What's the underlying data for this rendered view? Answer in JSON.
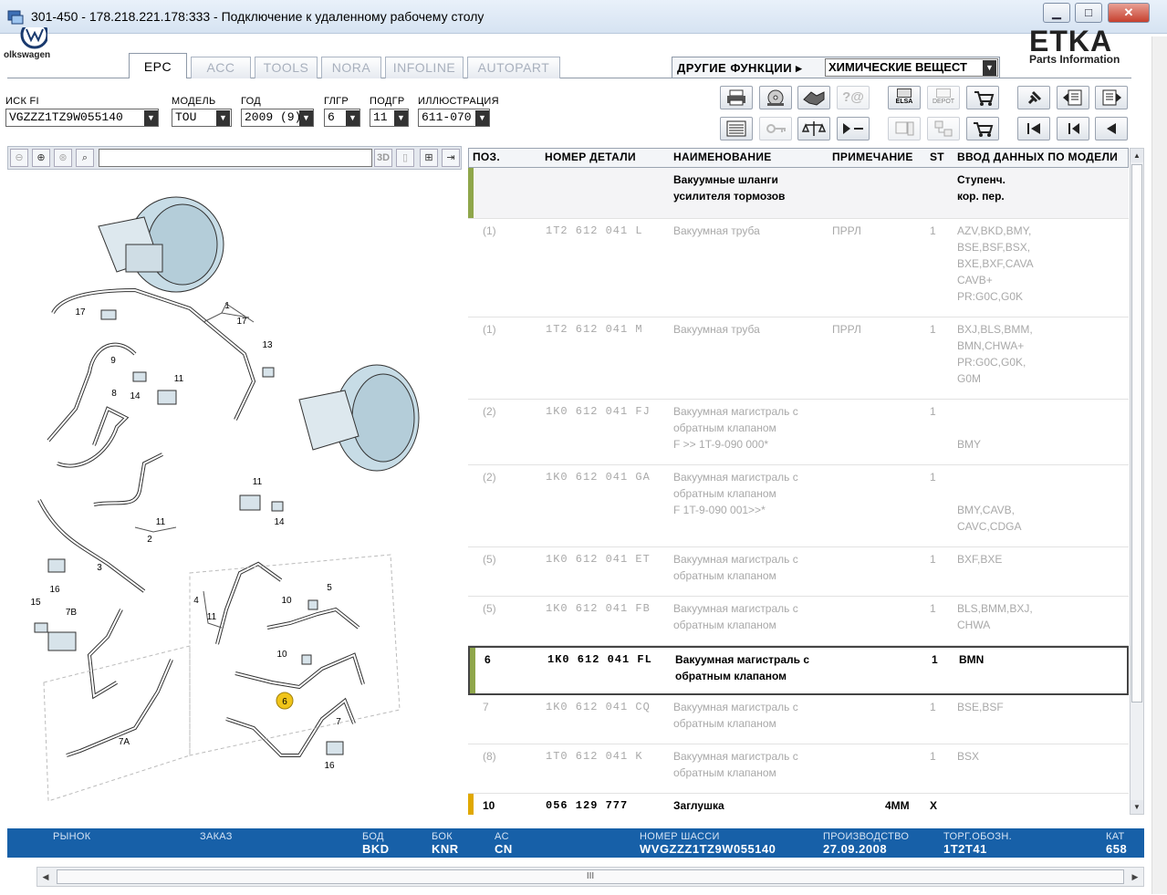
{
  "window": {
    "title": "301-450 - 178.218.221.178:333 - Подключение к удаленному рабочему столу",
    "btn_min": "▁",
    "btn_max": "□",
    "btn_close": "✕"
  },
  "header": {
    "logo_text": "olkswagen",
    "brand": "ETKA",
    "brand_sub": "Parts Information",
    "tabs": [
      {
        "label": "EPC",
        "active": true
      },
      {
        "label": "ACC",
        "active": false
      },
      {
        "label": "TOOLS",
        "active": false
      },
      {
        "label": "NORA",
        "active": false
      },
      {
        "label": "INFOLINE",
        "active": false
      },
      {
        "label": "AUTOPART",
        "active": false
      }
    ],
    "other_functions_label": "ДРУГИЕ ФУНКЦИИ ▸",
    "other_functions_value": "ХИМИЧЕСКИЕ ВЕЩЕСТ",
    "dd_arrow": "▼"
  },
  "selection": {
    "vin_label": "ИСК FI",
    "vin_value": "VGZZZ1TZ9W055140",
    "model_label": "МОДЕЛЬ",
    "model_value": "TOU",
    "year_label": "ГОД",
    "year_value": "2009 (9)",
    "hg_label": "ГЛГР",
    "hg_value": "6",
    "ug_label": "ПОДГР",
    "ug_value": "11",
    "illus_label": "ИЛЛЮСТРАЦИЯ",
    "illus_value": "611-070"
  },
  "toolbar": {
    "icons": [
      "print-icon",
      "cd-icon",
      "handshake-icon",
      "help-icon",
      "elsa-icon",
      "depot-icon",
      "cart-arrow-icon",
      "pin-icon",
      "page-back-icon",
      "page-forward-icon",
      "list-icon",
      "key-icon",
      "scale-icon",
      "play-minus-icon",
      "monitor-icon",
      "network-icon",
      "cart-icon",
      "first-icon",
      "prev-section-icon",
      "prev-icon"
    ],
    "elsa_text": "ELSA",
    "depot_text": "DEPOT",
    "help_text": "?@"
  },
  "illustration_tools": {
    "btn_3d": "3D",
    "callouts": [
      "1",
      "17",
      "17",
      "13",
      "9",
      "11",
      "14",
      "8",
      "11",
      "3",
      "2",
      "11",
      "14",
      "4",
      "11",
      "5",
      "10",
      "16",
      "15",
      "7B",
      "10",
      "6",
      "7",
      "7A",
      "16"
    ]
  },
  "parts_table": {
    "headers": [
      "ПОЗ.",
      "НОМЕР ДЕТАЛИ",
      "НАИМЕНОВАНИЕ",
      "ПРИМЕЧАНИЕ",
      "ST",
      "ВВОД ДАННЫХ ПО МОДЕЛИ"
    ],
    "group_title": "Вакуумные шланги\nусилителя тормозов",
    "group_model": "Ступенч.\nкор. пер.",
    "rows": [
      {
        "pos": "(1)",
        "part": "1T2 612 041 L",
        "name": "Вакуумная труба",
        "note": "ПРРЛ",
        "st": "1",
        "model": "AZV,BKD,BMY,\nBSE,BSF,BSX,\nBXE,BXF,CAVA\nCAVB+\nPR:G0C,G0K",
        "style": "grey"
      },
      {
        "pos": "(1)",
        "part": "1T2 612 041 M",
        "name": "Вакуумная труба",
        "note": "ПРРЛ",
        "st": "1",
        "model": "BXJ,BLS,BMM,\nBMN,CHWA+\nPR:G0C,G0K,\nG0M",
        "style": "grey"
      },
      {
        "pos": "(2)",
        "part": "1K0 612 041 FJ",
        "name": "Вакуумная магистраль с\nобратным клапаном\nF            >> 1T-9-090 000*",
        "note": "",
        "st": "1",
        "model": "\n\nBMY",
        "style": "grey"
      },
      {
        "pos": "(2)",
        "part": "1K0 612 041 GA",
        "name": "Вакуумная магистраль с\nобратным клапаном\nF 1T-9-090 001>>*",
        "note": "",
        "st": "1",
        "model": "\n\nBMY,CAVB,\nCAVC,CDGA",
        "style": "grey"
      },
      {
        "pos": "(5)",
        "part": "1K0 612 041 ET",
        "name": "Вакуумная магистраль с\nобратным клапаном",
        "note": "",
        "st": "1",
        "model": "BXF,BXE",
        "style": "grey"
      },
      {
        "pos": "(5)",
        "part": "1K0 612 041 FB",
        "name": "Вакуумная магистраль с\nобратным клапаном",
        "note": "",
        "st": "1",
        "model": "BLS,BMM,BXJ,\nCHWA",
        "style": "grey"
      },
      {
        "pos": "6",
        "part": "1K0 612 041 FL",
        "name": "Вакуумная магистраль с\nобратным клапаном",
        "note": "",
        "st": "1",
        "model": "BMN",
        "style": "black"
      },
      {
        "pos": "7",
        "part": "1K0 612 041 CQ",
        "name": "Вакуумная магистраль с\nобратным клапаном",
        "note": "",
        "st": "1",
        "model": "BSE,BSF",
        "style": "grey"
      },
      {
        "pos": "(8)",
        "part": "1T0 612 041 K",
        "name": "Вакуумная магистраль с\nобратным клапаном",
        "note": "",
        "st": "1",
        "model": "BSX",
        "style": "grey"
      },
      {
        "pos": "10",
        "part": "056 129 777",
        "name": "Заглушка",
        "note": "4MM",
        "st": "X",
        "model": "",
        "style": "black"
      }
    ]
  },
  "statusbar": {
    "market_label": "РЫНОК",
    "order_label": "ЗАКАЗ",
    "bod_label": "БОД",
    "bod_value": "BKD",
    "bok_label": "БОК",
    "bok_value": "KNR",
    "ac_label": "AC",
    "ac_value": "CN",
    "chassis_label": "НОМЕР ШАССИ",
    "chassis_value": "WVGZZZ1TZ9W055140",
    "prod_label": "ПРОИЗВОДСТВО",
    "prod_value": "27.09.2008",
    "trade_label": "ТОРГ.ОБОЗН.",
    "trade_value": "1T2T41",
    "cat_label": "КАТ",
    "cat_value": "658"
  },
  "scroll": {
    "grip": "III",
    "left": "◀",
    "right": "▶",
    "up": "▲",
    "down": "▼"
  },
  "colors": {
    "statusbar": "#1760a8",
    "selected_mark": "#8fa64a",
    "bullet_mark": "#e0a800",
    "callout_highlight": "#f0c419"
  }
}
